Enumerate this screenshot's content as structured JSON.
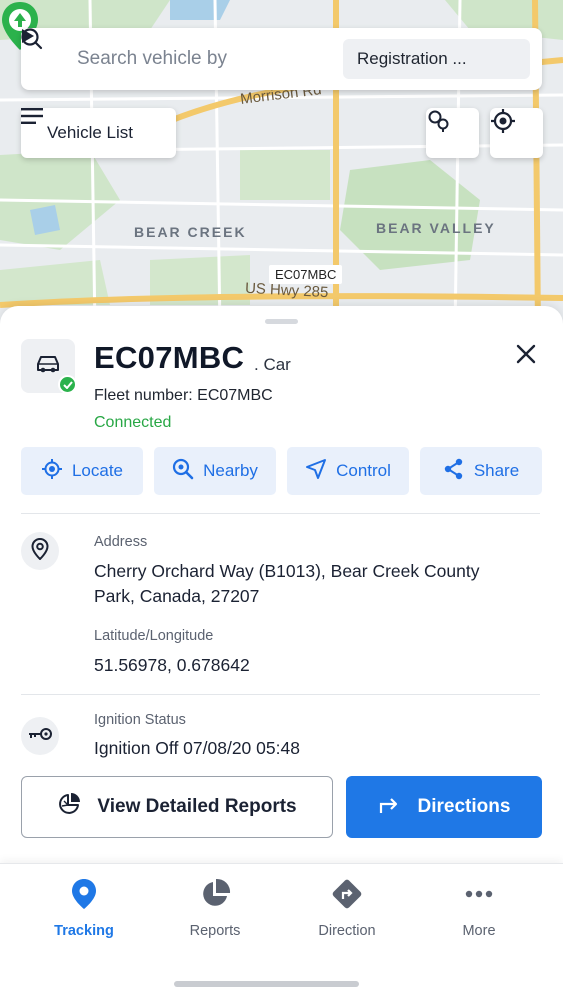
{
  "search": {
    "placeholder": "Search vehicle by",
    "filter_label": "Registration ..."
  },
  "map": {
    "vehicle_list_label": "Vehicle List",
    "areas": [
      "BEAR CREEK",
      "BEAR VALLEY"
    ],
    "streets": [
      "Morrison Rd",
      "US Hwy 285"
    ],
    "marker_label": "EC07MBC"
  },
  "vehicle": {
    "registration": "EC07MBC",
    "type": ". Car",
    "fleet_number": "Fleet number: EC07MBC",
    "status": "Connected",
    "status_color": "#28a745"
  },
  "actions": [
    {
      "label": "Locate",
      "icon": "crosshair-icon"
    },
    {
      "label": "Nearby",
      "icon": "search-icon"
    },
    {
      "label": "Control",
      "icon": "navigation-arrow-icon"
    },
    {
      "label": "Share",
      "icon": "share-icon"
    }
  ],
  "details": {
    "address_label": "Address",
    "address_value": "Cherry Orchard Way (B1013), Bear Creek County Park, Canada, 27207",
    "latlng_label": "Latitude/Longitude",
    "latlng_value": "51.56978, 0.678642",
    "ignition_label": "Ignition Status",
    "ignition_value": "Ignition Off 07/08/20 05:48"
  },
  "buttons": {
    "reports": "View Detailed Reports",
    "directions": "Directions"
  },
  "tabs": [
    {
      "label": "Tracking",
      "icon": "location-pin-icon",
      "active": true
    },
    {
      "label": "Reports",
      "icon": "pie-chart-icon",
      "active": false
    },
    {
      "label": "Direction",
      "icon": "direction-sign-icon",
      "active": false
    },
    {
      "label": "More",
      "icon": "more-dots-icon",
      "active": false
    }
  ],
  "colors": {
    "accent": "#1f78e6",
    "marker": "#2bb24c"
  }
}
